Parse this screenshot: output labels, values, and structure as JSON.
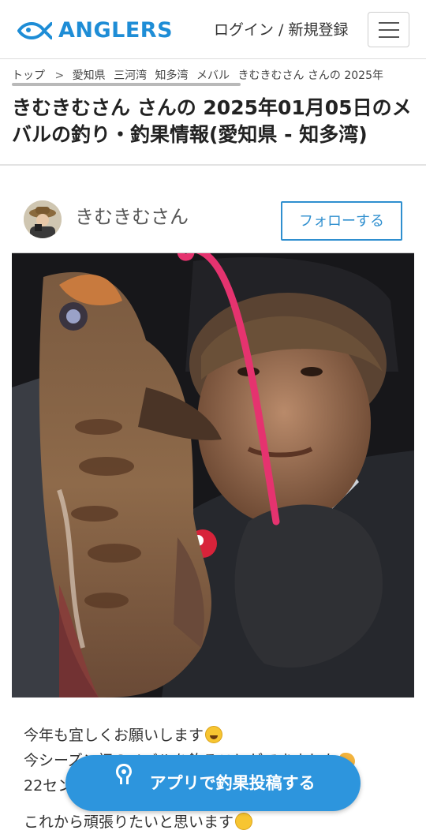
{
  "header": {
    "logo_text": "ANGLERS",
    "login_label": "ログイン / 新規登録",
    "menu_label": "menu-icon"
  },
  "breadcrumb": {
    "items": [
      "トップ",
      "愛知県",
      "三河湾",
      "知多湾",
      "メバル",
      "きむきむさん さんの 2025年"
    ],
    "separator": ">"
  },
  "page_title": "きむきむさん さんの 2025年01月05日のメバルの釣り・釣果情報(愛知県 - 知多湾)",
  "user": {
    "name": "きむきむさん",
    "follow_label": "フォローする"
  },
  "post": {
    "line1": "今年も宜しくお願いします",
    "line2": "今シーズン初のメバルを釣ることができました",
    "line3": "22センチ",
    "line4": "これから頑張りたいと思います"
  },
  "app_button": {
    "label": "アプリで釣果投稿する"
  },
  "colors": {
    "brand": "#1e8dd6",
    "follow": "#2f8fcf",
    "app_button": "#2d95dd"
  }
}
